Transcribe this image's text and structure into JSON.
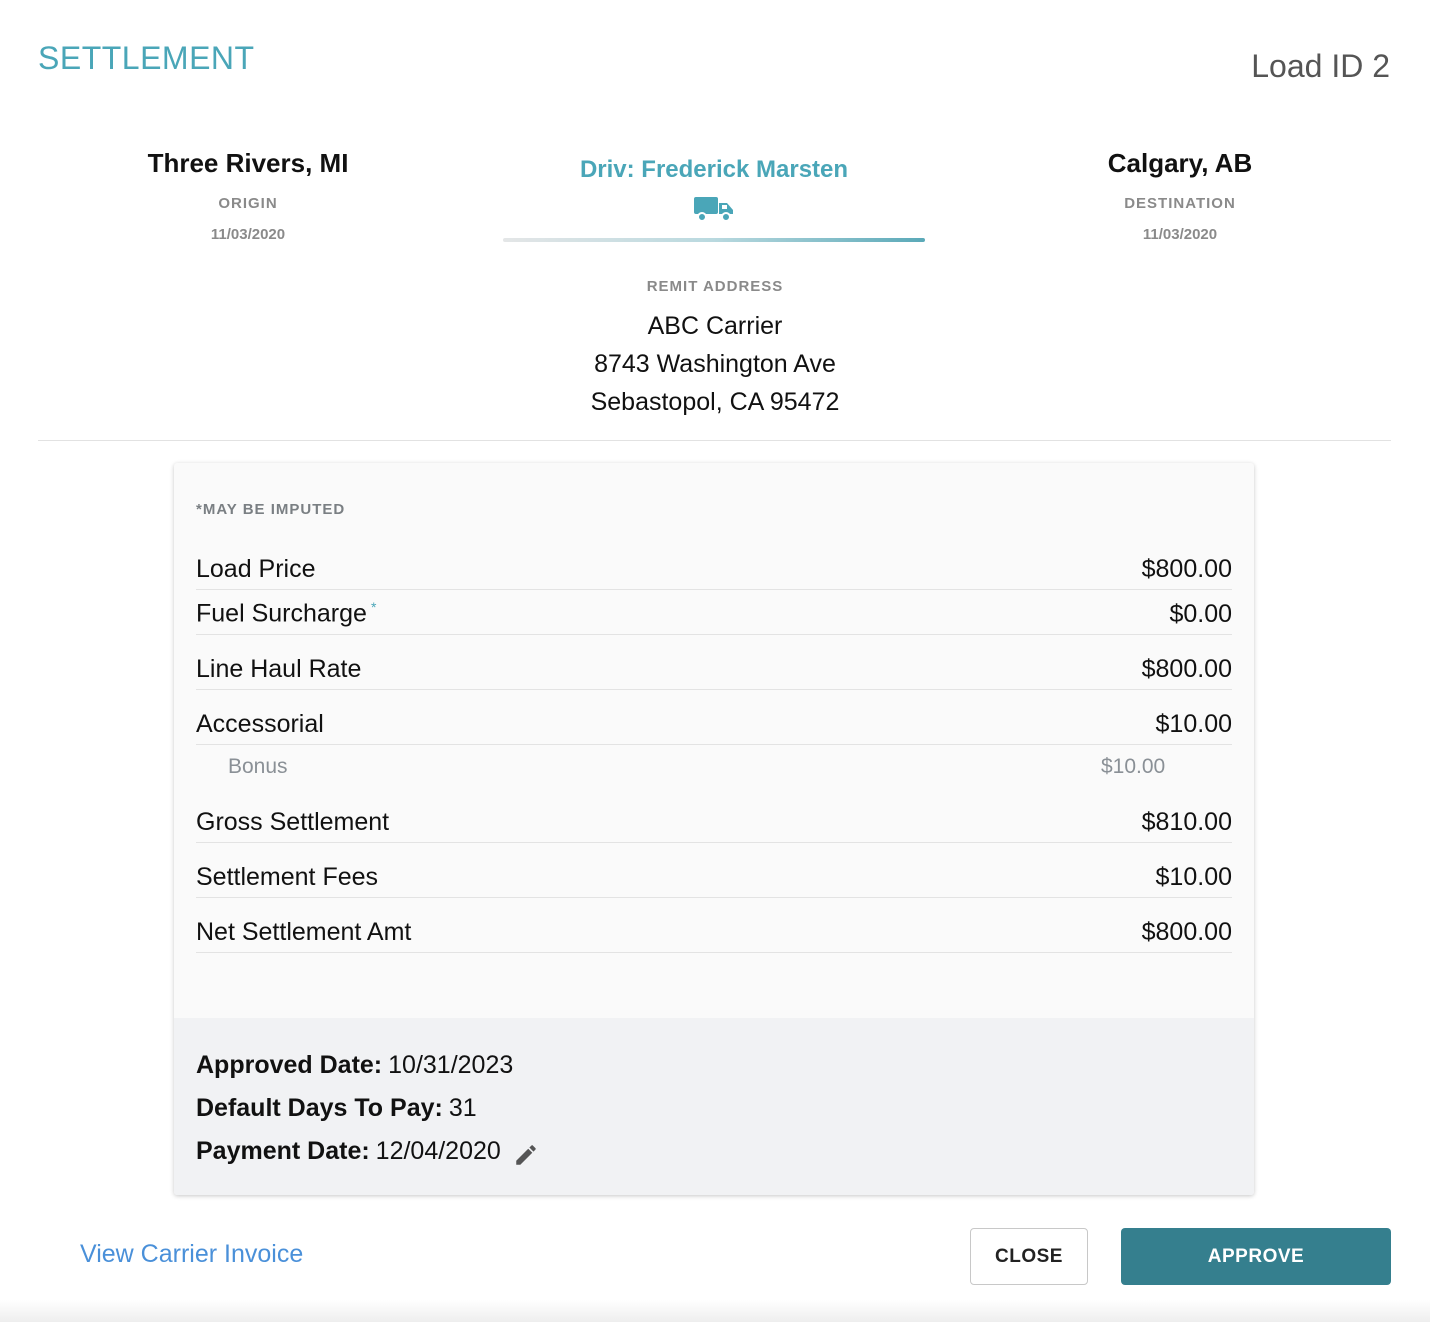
{
  "header": {
    "title": "SETTLEMENT",
    "load_id": "Load ID 2"
  },
  "route": {
    "origin": {
      "city": "Three Rivers, MI",
      "label": "ORIGIN",
      "date": "11/03/2020"
    },
    "destination": {
      "city": "Calgary, AB",
      "label": "DESTINATION",
      "date": "11/03/2020"
    },
    "driver": "Driv: Frederick Marsten",
    "driver_icon": "truck-icon",
    "accent_color": "#4aa6b8"
  },
  "remit": {
    "label": "REMIT ADDRESS",
    "name": "ABC Carrier",
    "street": "8743 Washington Ave",
    "city_state_zip": "Sebastopol, CA 95472"
  },
  "settlement": {
    "note": "*MAY BE IMPUTED",
    "load_price": {
      "label": "Load Price",
      "value": "$800.00"
    },
    "fuel_surcharge": {
      "label": "Fuel Surcharge",
      "marker": "*",
      "value": "$0.00"
    },
    "line_haul": {
      "label": "Line Haul Rate",
      "value": "$800.00"
    },
    "accessorial": {
      "label": "Accessorial",
      "value": "$10.00"
    },
    "bonus": {
      "label": "Bonus",
      "value": "$10.00"
    },
    "gross": {
      "label": "Gross Settlement",
      "value": "$810.00"
    },
    "fees": {
      "label": "Settlement Fees",
      "value": "$10.00"
    },
    "net": {
      "label": "Net Settlement Amt",
      "value": "$800.00"
    }
  },
  "dates": {
    "approved_label": "Approved Date:",
    "approved_value": "10/31/2023",
    "days_label": "Default Days To Pay:",
    "days_value": "31",
    "payment_label": "Payment Date:",
    "payment_value": "12/04/2020",
    "edit_icon": "pencil-icon"
  },
  "actions": {
    "view_invoice": "View Carrier Invoice",
    "close": "CLOSE",
    "approve": "APPROVE",
    "approve_color": "#357f8e"
  }
}
